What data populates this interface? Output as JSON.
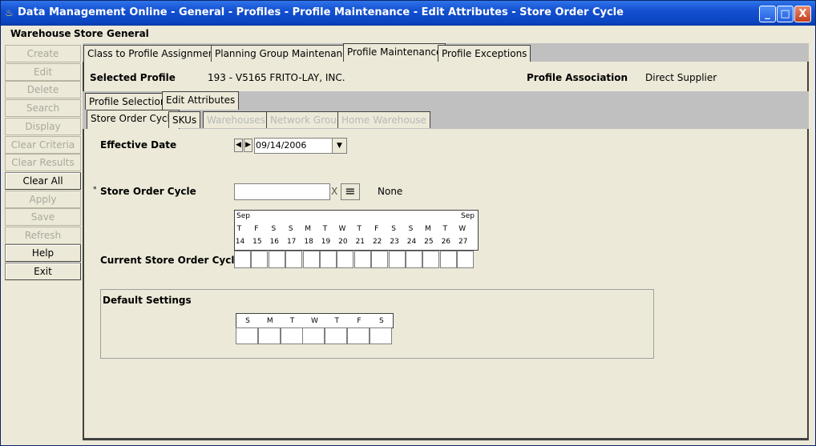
{
  "window": {
    "title": "Data Management Online - General - Profiles - Profile Maintenance - Edit Attributes - Store Order Cycle",
    "controls": {
      "minimize": "_",
      "maximize": "□",
      "close": "X"
    }
  },
  "menubar": [
    "Warehouse",
    "Store",
    "General"
  ],
  "left_buttons": [
    {
      "label": "Create",
      "enabled": false
    },
    {
      "label": "Edit",
      "enabled": false
    },
    {
      "label": "Delete",
      "enabled": false
    },
    {
      "label": "Search",
      "enabled": false
    },
    {
      "label": "Display",
      "enabled": false
    },
    {
      "label": "Clear Criteria",
      "enabled": false
    },
    {
      "label": "Clear Results",
      "enabled": false
    },
    {
      "label": "Clear All",
      "enabled": true
    },
    {
      "label": "Apply",
      "enabled": false
    },
    {
      "label": "Save",
      "enabled": false
    },
    {
      "label": "Refresh",
      "enabled": false
    },
    {
      "label": "Help",
      "enabled": true
    },
    {
      "label": "Exit",
      "enabled": true
    }
  ],
  "top_tabs": [
    "Class to Profile Assignment",
    "Planning Group Maintenance",
    "Profile Maintenance",
    "Profile Exceptions"
  ],
  "profile": {
    "selected_label": "Selected Profile",
    "selected_value": "193 - V5165 FRITO-LAY, INC.",
    "association_label": "Profile Association",
    "association_value": "Direct Supplier"
  },
  "sub_tabs": [
    "Profile Selection",
    "Edit Attributes"
  ],
  "attr_tabs": [
    {
      "label": "Store Order Cycle",
      "enabled": true
    },
    {
      "label": "SKUs",
      "enabled": true
    },
    {
      "label": "Warehouses",
      "enabled": false
    },
    {
      "label": "Network Group",
      "enabled": false
    },
    {
      "label": "Home Warehouse",
      "enabled": false
    }
  ],
  "effective_date": {
    "label": "Effective Date",
    "value": "09/14/2006",
    "prev": "◀",
    "next": "▶",
    "dropdown": "▼"
  },
  "store_order_cycle": {
    "label": "Store Order Cycle",
    "required_marker": "*",
    "value": "",
    "clear_glyph": "X",
    "list_glyph": "≡",
    "display": "None"
  },
  "calendar": {
    "month_left": "Sep",
    "month_right": "Sep",
    "weekdays": [
      "T",
      "F",
      "S",
      "S",
      "M",
      "T",
      "W",
      "T",
      "F",
      "S",
      "S",
      "M",
      "T",
      "W"
    ],
    "days": [
      "14",
      "15",
      "16",
      "17",
      "18",
      "19",
      "20",
      "21",
      "22",
      "23",
      "24",
      "25",
      "26",
      "27"
    ]
  },
  "current_cycle_label": "Current Store Order Cycle",
  "default_settings": {
    "label": "Default Settings",
    "weekdays": [
      "S",
      "M",
      "T",
      "W",
      "T",
      "F",
      "S"
    ]
  }
}
